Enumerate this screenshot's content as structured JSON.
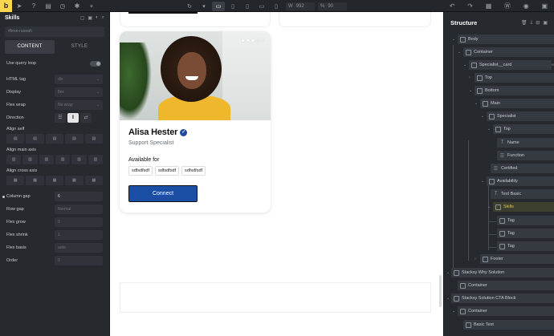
{
  "topbar": {
    "logo": "b",
    "left_icons": [
      "cursor-icon",
      "help-icon",
      "layers-icon",
      "history-icon",
      "gear-icon",
      "plus-icon"
    ],
    "width_value": "992",
    "width_label": "W",
    "zoom_value": "90",
    "zoom_label": "%",
    "right_icons": [
      "undo-icon",
      "redo-icon",
      "pages-icon",
      "wordpress-icon",
      "preview-icon",
      "save-icon"
    ]
  },
  "left_panel": {
    "title": "Skills",
    "class_placeholder": "#brxe-ruoeah",
    "tabs": [
      "CONTENT",
      "STYLE"
    ],
    "active_tab": "CONTENT",
    "use_query_loop": "Use query loop",
    "html_tag": {
      "label": "HTML tag",
      "value": "div"
    },
    "display": {
      "label": "Display",
      "value": "flex"
    },
    "flex_wrap": {
      "label": "Flex wrap",
      "value": "No wrap"
    },
    "direction": {
      "label": "Direction"
    },
    "align_self": {
      "label": "Align self"
    },
    "align_main_axis": {
      "label": "Align main axis"
    },
    "align_cross_axis": {
      "label": "Align cross axis"
    },
    "column_gap": {
      "label": "Column gap",
      "value": "6"
    },
    "row_gap": {
      "label": "Row gap",
      "value": "Normal"
    },
    "flex_grow": {
      "label": "Flex grow",
      "value": "0"
    },
    "flex_shrink": {
      "label": "Flex shrink",
      "value": "1"
    },
    "flex_basis": {
      "label": "Flex basis",
      "value": "auto"
    },
    "order": {
      "label": "Order",
      "value": "0"
    }
  },
  "canvas": {
    "card": {
      "rating": "★★★☆☆",
      "name": "Alisa Hester",
      "function": "Support Specialist",
      "available_label": "Available for",
      "tags": [
        "sdfsdfsdf",
        "sdfsdfsdf",
        "sdfsdfsdf"
      ],
      "button": "Connect"
    }
  },
  "structure": {
    "title": "Structure",
    "nodes": [
      "Body",
      "Container",
      "Specialist__card",
      "Top",
      "Bottom",
      "Main",
      "Specialist",
      "Top",
      "Name",
      "Function",
      "Certified",
      "Availability",
      "Text Basic",
      "Skills",
      "Tag",
      "Tag",
      "Tag",
      "Footer",
      "Stacksy Why Solution",
      "Container",
      "Stacksy Solution CTA Block",
      "Container",
      "Basic Text"
    ]
  },
  "colors": {
    "accent": "#ffd64f",
    "button": "#1b4fa5",
    "selected": "#e3c94f",
    "panel": "#26292d"
  }
}
